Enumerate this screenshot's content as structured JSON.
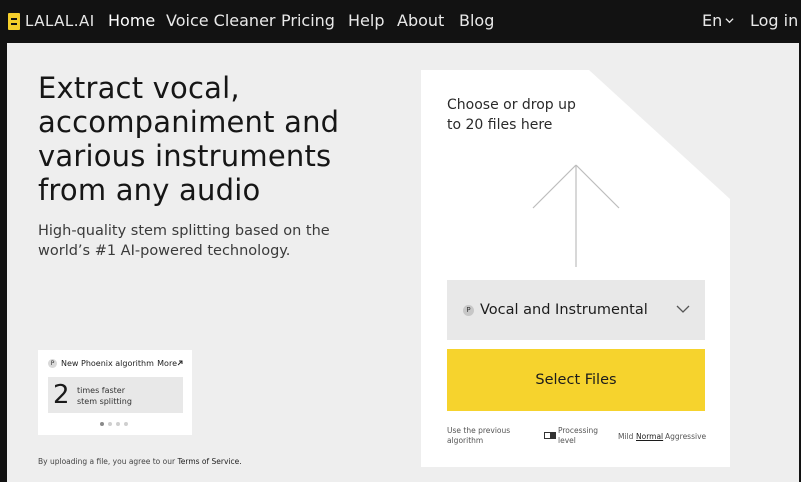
{
  "brand": {
    "name": "LALAL.AI"
  },
  "nav": {
    "items": [
      {
        "label": "Home"
      },
      {
        "label": "Voice Cleaner"
      },
      {
        "label": "Pricing"
      },
      {
        "label": "Help"
      },
      {
        "label": "About"
      },
      {
        "label": "Blog"
      }
    ],
    "language": "En",
    "login": "Log in"
  },
  "hero": {
    "title": "Extract vocal, accompaniment and various instruments from any audio",
    "subtitle": "High-quality stem splitting based on the world’s #1 AI-powered technology."
  },
  "promo": {
    "badge": "P",
    "title": "New Phoenix algorithm",
    "more": "More",
    "more_icon": "arrow-up-right-icon",
    "number": "2",
    "desc_line1": "times faster",
    "desc_line2": "stem splitting",
    "slides": 4,
    "active_slide": 1
  },
  "terms": {
    "text": "By uploading a file, you agree to our",
    "link": "Terms of Service."
  },
  "upload": {
    "hint": "Choose or drop up to 20 files here",
    "algorithm_badge": "P",
    "stem_option": "Vocal and Instrumental",
    "select_button": "Select Files",
    "previous_algorithm": "Use the previous algorithm",
    "processing_level_label": "Processing level",
    "levels": [
      "Mild",
      "Normal",
      "Aggressive"
    ],
    "selected_level": "Normal"
  },
  "colors": {
    "nav_bg": "#121212",
    "page_bg": "#eeeeee",
    "accent": "#f6d32d",
    "panel": "#ffffff"
  }
}
